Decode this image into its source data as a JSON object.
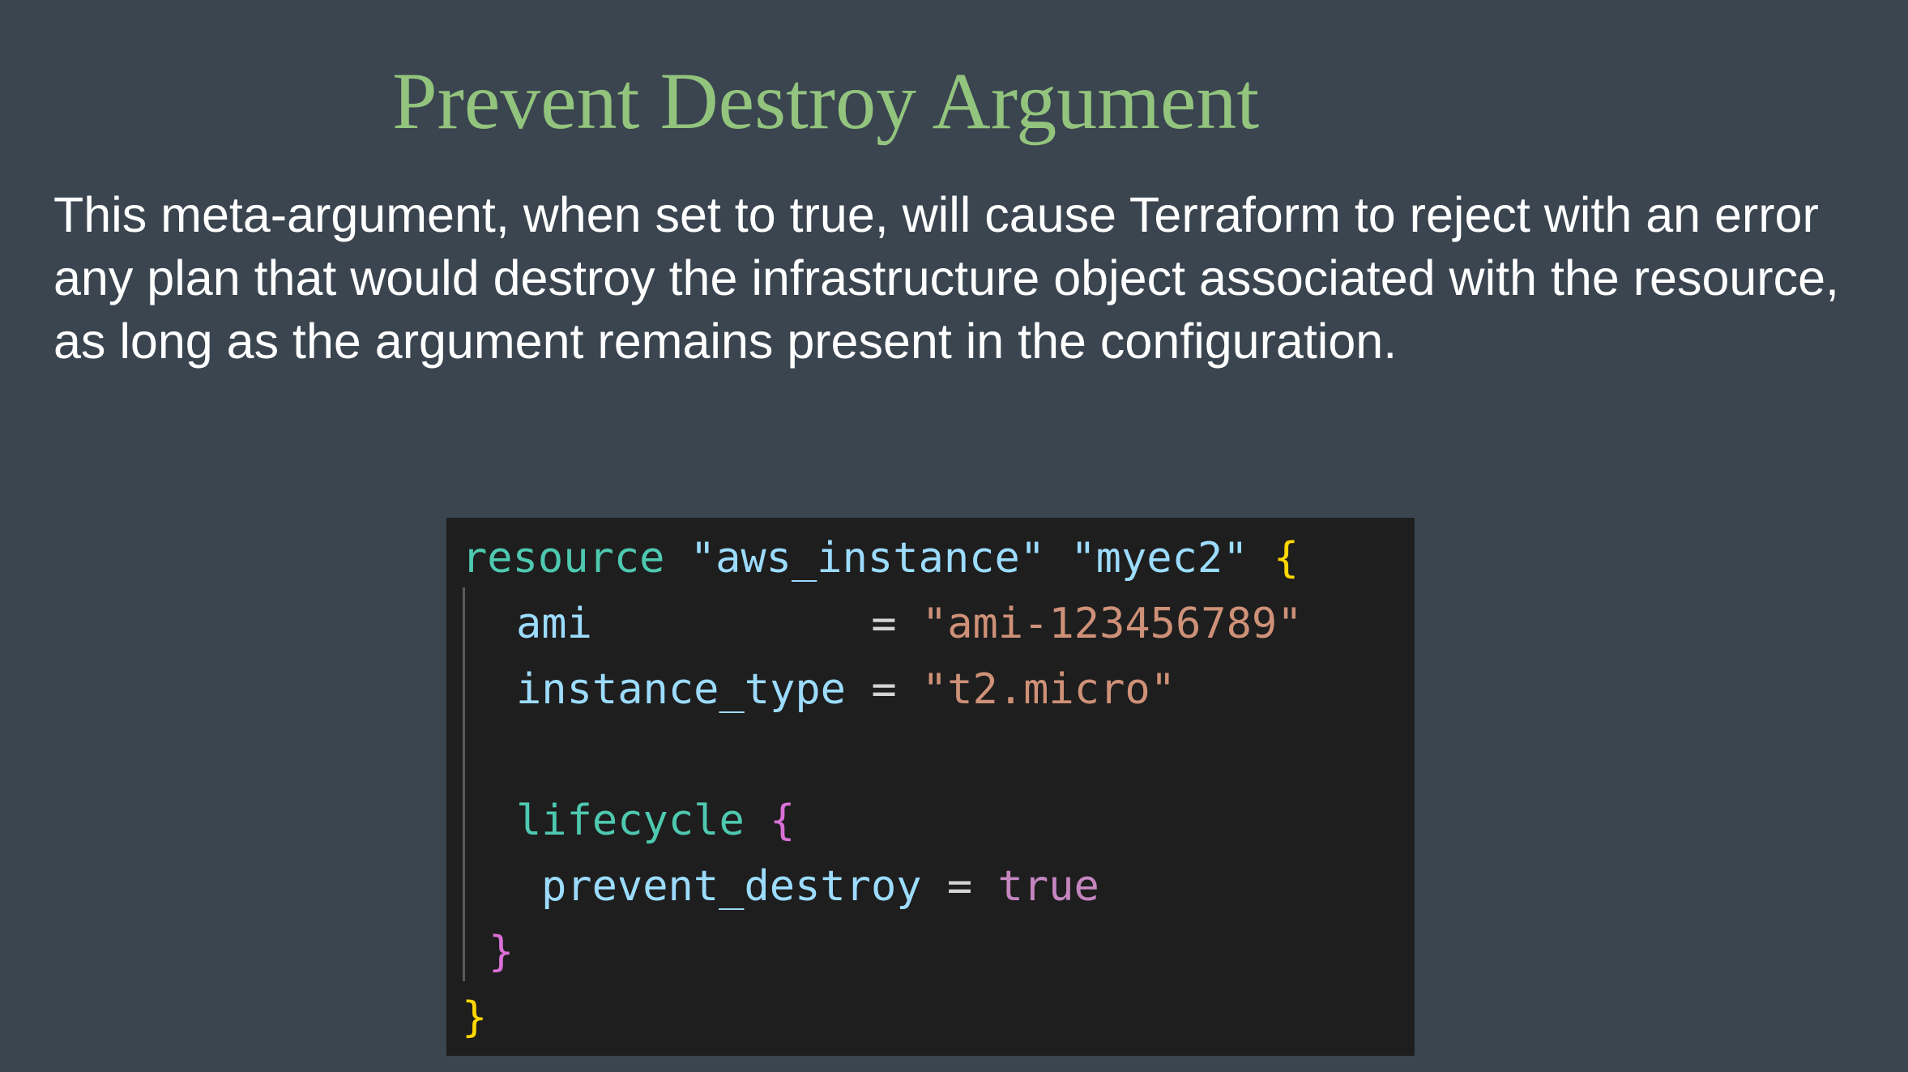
{
  "slide": {
    "title": "Prevent Destroy Argument",
    "body": "This meta-argument, when set to true, will cause Terraform to reject with an error any plan that would destroy the infrastructure object associated with the resource, as long as the argument remains present in the configuration."
  },
  "code": {
    "line1": {
      "keyword": "resource",
      "type": "\"aws_instance\"",
      "name": "\"myec2\"",
      "brace": "{"
    },
    "line2": {
      "key": "ami",
      "eq": "=",
      "value": "\"ami-123456789\""
    },
    "line3": {
      "key": "instance_type",
      "eq": "=",
      "value": "\"t2.micro\""
    },
    "line5": {
      "keyword": "lifecycle",
      "brace": "{"
    },
    "line6": {
      "key": "prevent_destroy",
      "eq": "=",
      "value": "true"
    },
    "line7": {
      "brace": "}"
    },
    "line8": {
      "brace": "}"
    }
  },
  "colors": {
    "background": "#3a4550",
    "title": "#93c47d",
    "body_text": "#ffffff",
    "code_background": "#1e1e1e",
    "keyword": "#4ec9b0",
    "string_blue": "#9cdcfe",
    "string_orange": "#ce9178",
    "brace_outer": "#ffd700",
    "brace_inner": "#da70d6",
    "boolean": "#c586c0"
  }
}
